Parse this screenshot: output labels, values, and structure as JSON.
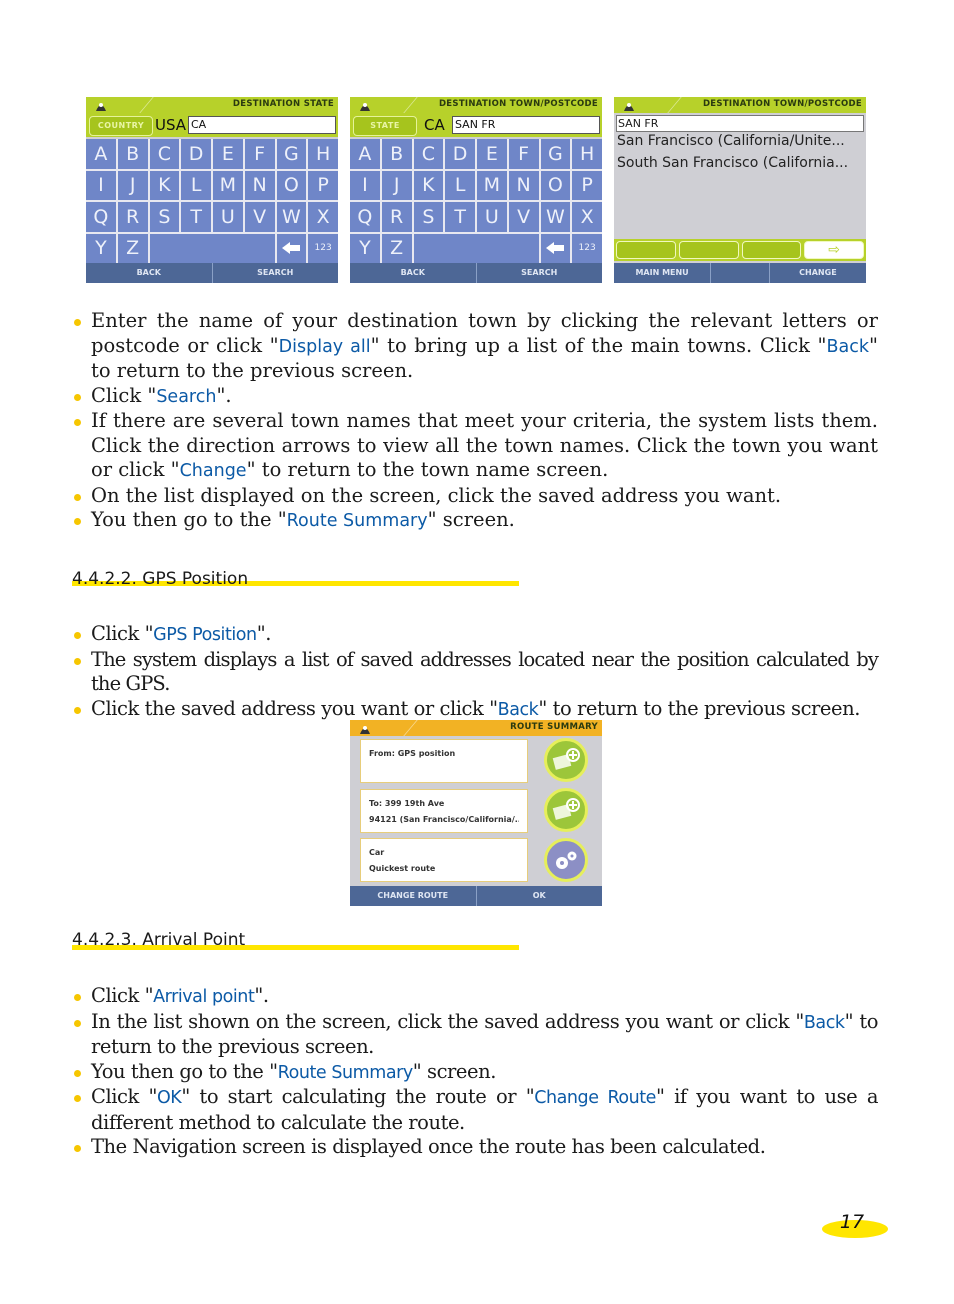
{
  "screens": {
    "state": {
      "title": "DESTINATION STATE",
      "mode_button": "COUNTRY",
      "prefix": "USA",
      "input_value": "CA",
      "keys": [
        "A",
        "B",
        "C",
        "D",
        "E",
        "F",
        "G",
        "H",
        "I",
        "J",
        "K",
        "L",
        "M",
        "N",
        "O",
        "P",
        "Q",
        "R",
        "S",
        "T",
        "U",
        "V",
        "W",
        "X",
        "Y",
        "Z"
      ],
      "numeric_key": "123",
      "backspace_icon": "arrow-left",
      "buttons": [
        "BACK",
        "SEARCH"
      ]
    },
    "town": {
      "title": "DESTINATION TOWN/POSTCODE",
      "mode_button": "STATE",
      "prefix": "CA",
      "input_value": "SAN FR",
      "keys": [
        "A",
        "B",
        "C",
        "D",
        "E",
        "F",
        "G",
        "H",
        "I",
        "J",
        "K",
        "L",
        "M",
        "N",
        "O",
        "P",
        "Q",
        "R",
        "S",
        "T",
        "U",
        "V",
        "W",
        "X",
        "Y",
        "Z"
      ],
      "numeric_key": "123",
      "backspace_icon": "arrow-left",
      "buttons": [
        "BACK",
        "SEARCH"
      ]
    },
    "results": {
      "title": "DESTINATION TOWN/POSTCODE",
      "input_value": "SAN FR",
      "items": [
        "San Francisco (California/Unite...",
        "South San Francisco (California..."
      ],
      "next_icon": "arrow-right",
      "buttons": [
        "MAIN MENU",
        "",
        "CHANGE"
      ]
    },
    "route_summary": {
      "title": "ROUTE SUMMARY",
      "from_line": "From: GPS position",
      "to_line1": "To: 399 19th Ave",
      "to_line2": "94121 (San Francisco/California/...",
      "mode_line1": "Car",
      "mode_line2": "Quickest route",
      "buttons": [
        "CHANGE ROUTE",
        "OK"
      ]
    }
  },
  "section1": {
    "b1": {
      "pre": "Enter the name of your destination town by clicking the relevant letters or postcode or click \"",
      "kw1": "Display all",
      "mid": "\" to bring up a list of the main towns. Click \"",
      "kw2": "Back",
      "post": "\" to return to the previous screen."
    },
    "b2": {
      "pre": "Click \"",
      "kw": "Search",
      "post": "\"."
    },
    "b3": {
      "pre": "If there are several town names that meet your criteria, the system lists them. Click the direction arrows to view all the town names. Click the town you want or click \"",
      "kw": "Change",
      "post": "\" to return to the town name screen."
    },
    "b4": {
      "text": "On the list displayed on the screen, click the saved address you want."
    },
    "b5": {
      "pre": "You then go to the \"",
      "kw": "Route Summary",
      "post": "\" screen."
    }
  },
  "section2": {
    "heading": "4.4.2.2. GPS Position",
    "b1": {
      "pre": "Click \"",
      "kw": "GPS Position",
      "post": "\"."
    },
    "b2": {
      "text": "The system displays a list of saved addresses located near the position calculated by the GPS."
    },
    "b3": {
      "pre": "Click the saved address you want or click \"",
      "kw": "Back",
      "post": "\" to return to the previous screen."
    }
  },
  "section3": {
    "heading": "4.4.2.3. Arrival Point",
    "b1": {
      "pre": "Click \"",
      "kw": "Arrival point",
      "post": "\"."
    },
    "b2": {
      "pre": "In the list shown on the screen, click the saved address you want or click \"",
      "kw": "Back",
      "post": "\" to return to the previous screen."
    },
    "b3": {
      "pre": "You then go to the \"",
      "kw": "Route Summary",
      "post": "\" screen."
    },
    "b4": {
      "pre": "Click \"",
      "kw1": "OK",
      "mid": "\" to start calculating the route or \"",
      "kw2": "Change Route",
      "post": "\" if you want to use a different method to calculate the route."
    },
    "b5": {
      "text": "The Navigation screen is displayed once the route has been calculated."
    }
  },
  "page_number": "17",
  "colors": {
    "accent_yellow": "#ffe600",
    "keyword_blue": "#0c5aa6",
    "device_green": "#b7d12a",
    "key_blue": "#6f86c8",
    "bar_navy": "#4d6796"
  }
}
